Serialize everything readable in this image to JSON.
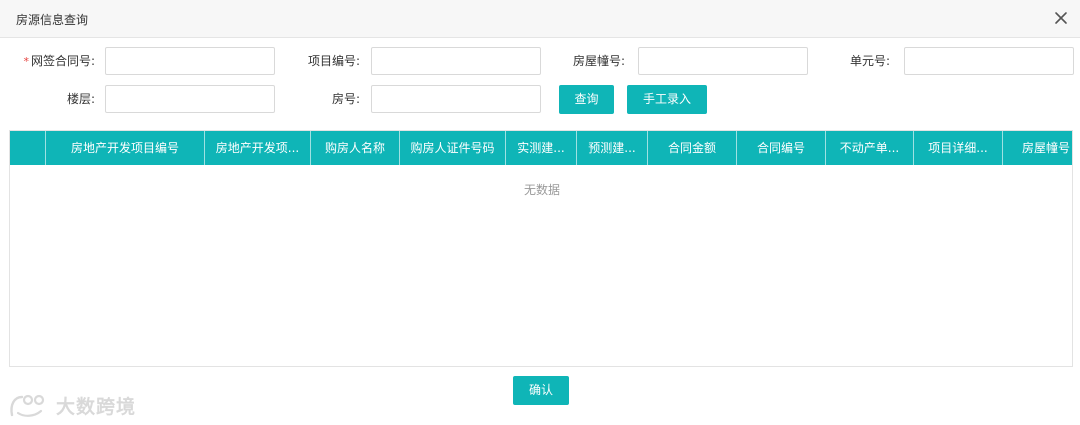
{
  "dialog": {
    "title": "房源信息查询"
  },
  "form": {
    "contract_no": {
      "label": "网签合同号:",
      "required_mark": "*",
      "value": "",
      "placeholder": ""
    },
    "project_no": {
      "label": "项目编号:",
      "value": "",
      "placeholder": ""
    },
    "building_no": {
      "label": "房屋幢号:",
      "value": "",
      "placeholder": ""
    },
    "unit_no": {
      "label": "单元号:",
      "value": "",
      "placeholder": ""
    },
    "floor": {
      "label": "楼层:",
      "value": "",
      "placeholder": ""
    },
    "room_no": {
      "label": "房号:",
      "value": "",
      "placeholder": ""
    },
    "query_label": "查询",
    "manual_label": "手工录入"
  },
  "table": {
    "columns": [
      "",
      "房地产开发项目编号",
      "房地产开发项...",
      "购房人名称",
      "购房人证件号码",
      "实测建...",
      "预测建...",
      "合同金额",
      "合同编号",
      "不动产单...",
      "项目详细...",
      "房屋幢号"
    ],
    "rows": [],
    "empty_text": "无数据"
  },
  "footer": {
    "confirm_label": "确认"
  },
  "watermark": {
    "text": "大数跨境"
  },
  "colors": {
    "accent": "#0fb5b7",
    "required": "#e64340"
  }
}
